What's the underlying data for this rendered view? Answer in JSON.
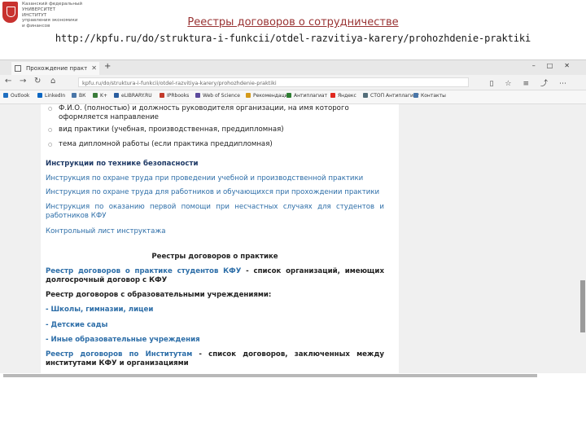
{
  "header": {
    "logo_lines": [
      "Казанский федеральный",
      "УНИВЕРСИТЕТ",
      "ИНСТИТУТ",
      "управления экономики",
      "и финансов"
    ],
    "title": "Реестры договоров о сотрудничестве",
    "subtitle": "http://kpfu.ru/do/struktura-i-funkcii/otdel-razvitiya-karery/prohozhdenie-praktiki"
  },
  "browser": {
    "tab_title": "Прохождение практ",
    "url": "kpfu.ru/do/struktura-i-funkcii/otdel-razvitiya-karery/prohozhdenie-praktiki",
    "bookmarks": [
      {
        "label": "Outlook",
        "color": "#1f6fc1"
      },
      {
        "label": "LinkedIn",
        "color": "#0a66c2"
      },
      {
        "label": "ВК",
        "color": "#4a76a8"
      },
      {
        "label": "K+",
        "color": "#3a7c3a"
      },
      {
        "label": "eLIBRARY.RU",
        "color": "#2a5d9f"
      },
      {
        "label": "IPRbooks",
        "color": "#c23a2a"
      },
      {
        "label": "Web of Science",
        "color": "#5c4a9c"
      },
      {
        "label": "Рекомендации",
        "color": "#d49a1a"
      },
      {
        "label": "Антиплагиат",
        "color": "#2e7d32"
      },
      {
        "label": "Яндекс",
        "color": "#e0281f"
      },
      {
        "label": "СТОП Антиплагиат",
        "color": "#546e7a"
      },
      {
        "label": "Контакты",
        "color": "#4a76a8"
      }
    ]
  },
  "content": {
    "bullet_1": "Ф.И.О. (полностью) и должность руководителя организации, на имя которого оформляется направление",
    "bullet_2": "вид практики (учебная, производственная, преддипломная)",
    "bullet_3": "тема дипломной работы (если практика преддипломная)",
    "safety_heading": "Инструкции по технике безопасности",
    "safety_link_1": "Инструкция по охране труда при проведении учебной и производственной практики",
    "safety_link_2": "Инструкция по охране труда для работников и обучающихся при прохождении практики",
    "safety_link_3": "Инструкция по оказанию первой помощи при несчастных случаях для студентов и работников КФУ",
    "safety_link_4": "Контрольный лист инструктажа",
    "registry_heading": "Реестры договоров о практике",
    "registry_students_link": "Реестр договоров о практике студентов КФУ",
    "registry_students_text": " - список организаций, имеющих долгосрочный договор с КФУ",
    "edu_heading": "Реестр договоров с образовательными учреждениями:",
    "edu_link_1": "- Школы, гимназии, лицеи",
    "edu_link_2": "- Детские сады",
    "edu_link_3": "- Иные образовательные учреждения",
    "inst_link": "Реестр договоров по Институтам",
    "inst_text": " - список договоров, заключенных между институтами КФУ и организациями"
  }
}
